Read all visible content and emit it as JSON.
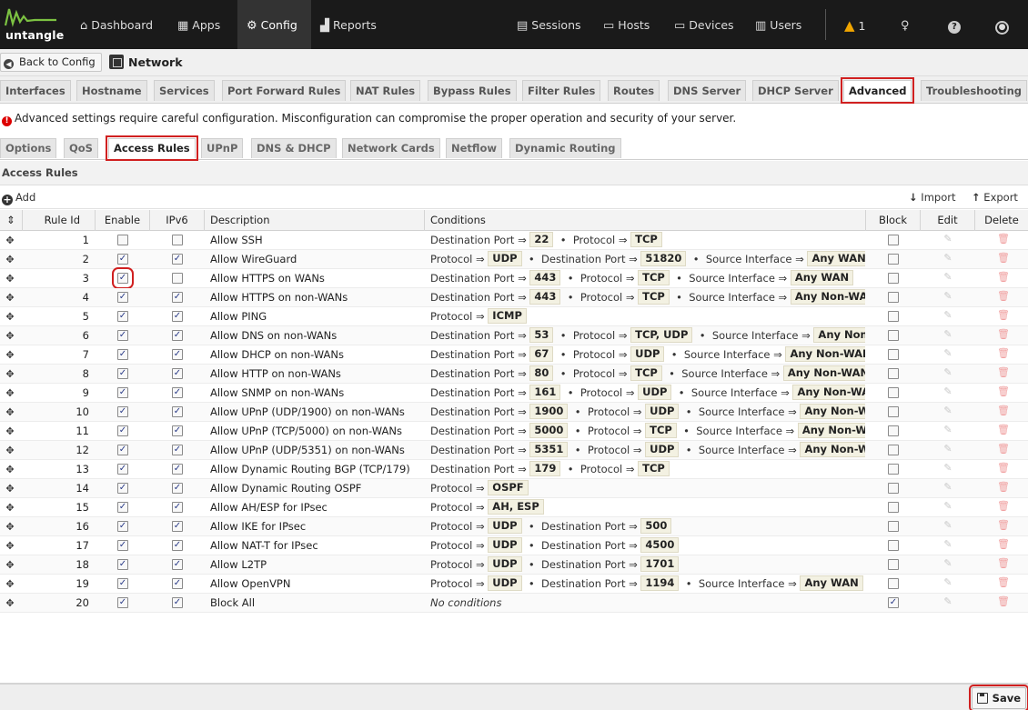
{
  "brand": {
    "name": "untangle"
  },
  "nav": {
    "dashboard": "Dashboard",
    "apps": "Apps",
    "config": "Config",
    "reports": "Reports",
    "sessions": "Sessions",
    "hosts": "Hosts",
    "devices": "Devices",
    "users": "Users",
    "alert_count": "1"
  },
  "breadcrumb": {
    "back_label": "Back to Config",
    "title": "Network"
  },
  "tabs": [
    "Interfaces",
    "Hostname",
    "Services",
    "Port Forward Rules",
    "NAT Rules",
    "Bypass Rules",
    "Filter Rules",
    "Routes",
    "DNS Server",
    "DHCP Server",
    "Advanced",
    "Troubleshooting"
  ],
  "warning": "Advanced settings require careful configuration. Misconfiguration can compromise the proper operation and security of your server.",
  "subtabs": [
    "Options",
    "QoS",
    "Access Rules",
    "UPnP",
    "DNS & DHCP",
    "Network Cards",
    "Netflow",
    "Dynamic Routing"
  ],
  "panel_title": "Access Rules",
  "toolbar": {
    "add": "Add",
    "import": "Import",
    "export": "Export"
  },
  "columns": {
    "rule_id": "Rule Id",
    "enable": "Enable",
    "ipv6": "IPv6",
    "description": "Description",
    "conditions": "Conditions",
    "block": "Block",
    "edit": "Edit",
    "delete": "Delete"
  },
  "rules": [
    {
      "id": "1",
      "enable": false,
      "ipv6": false,
      "block": false,
      "description": "Allow SSH",
      "conditions": [
        [
          "Destination Port",
          "22"
        ],
        [
          "Protocol",
          "TCP"
        ]
      ]
    },
    {
      "id": "2",
      "enable": true,
      "ipv6": true,
      "block": false,
      "description": "Allow WireGuard",
      "conditions": [
        [
          "Protocol",
          "UDP"
        ],
        [
          "Destination Port",
          "51820"
        ],
        [
          "Source Interface",
          "Any WAN"
        ]
      ]
    },
    {
      "id": "3",
      "enable": true,
      "ipv6": false,
      "block": false,
      "description": "Allow HTTPS on WANs",
      "conditions": [
        [
          "Destination Port",
          "443"
        ],
        [
          "Protocol",
          "TCP"
        ],
        [
          "Source Interface",
          "Any WAN"
        ]
      ]
    },
    {
      "id": "4",
      "enable": true,
      "ipv6": true,
      "block": false,
      "description": "Allow HTTPS on non-WANs",
      "conditions": [
        [
          "Destination Port",
          "443"
        ],
        [
          "Protocol",
          "TCP"
        ],
        [
          "Source Interface",
          "Any Non-WAN"
        ]
      ]
    },
    {
      "id": "5",
      "enable": true,
      "ipv6": true,
      "block": false,
      "description": "Allow PING",
      "conditions": [
        [
          "Protocol",
          "ICMP"
        ]
      ]
    },
    {
      "id": "6",
      "enable": true,
      "ipv6": true,
      "block": false,
      "description": "Allow DNS on non-WANs",
      "conditions": [
        [
          "Destination Port",
          "53"
        ],
        [
          "Protocol",
          "TCP, UDP"
        ],
        [
          "Source Interface",
          "Any Non-..."
        ]
      ]
    },
    {
      "id": "7",
      "enable": true,
      "ipv6": true,
      "block": false,
      "description": "Allow DHCP on non-WANs",
      "conditions": [
        [
          "Destination Port",
          "67"
        ],
        [
          "Protocol",
          "UDP"
        ],
        [
          "Source Interface",
          "Any Non-WAN"
        ]
      ]
    },
    {
      "id": "8",
      "enable": true,
      "ipv6": true,
      "block": false,
      "description": "Allow HTTP on non-WANs",
      "conditions": [
        [
          "Destination Port",
          "80"
        ],
        [
          "Protocol",
          "TCP"
        ],
        [
          "Source Interface",
          "Any Non-WAN"
        ]
      ]
    },
    {
      "id": "9",
      "enable": true,
      "ipv6": true,
      "block": false,
      "description": "Allow SNMP on non-WANs",
      "conditions": [
        [
          "Destination Port",
          "161"
        ],
        [
          "Protocol",
          "UDP"
        ],
        [
          "Source Interface",
          "Any Non-WAN"
        ]
      ]
    },
    {
      "id": "10",
      "enable": true,
      "ipv6": true,
      "block": false,
      "description": "Allow UPnP (UDP/1900) on non-WANs",
      "conditions": [
        [
          "Destination Port",
          "1900"
        ],
        [
          "Protocol",
          "UDP"
        ],
        [
          "Source Interface",
          "Any Non-W..."
        ]
      ]
    },
    {
      "id": "11",
      "enable": true,
      "ipv6": true,
      "block": false,
      "description": "Allow UPnP (TCP/5000) on non-WANs",
      "conditions": [
        [
          "Destination Port",
          "5000"
        ],
        [
          "Protocol",
          "TCP"
        ],
        [
          "Source Interface",
          "Any Non-W..."
        ]
      ]
    },
    {
      "id": "12",
      "enable": true,
      "ipv6": true,
      "block": false,
      "description": "Allow UPnP (UDP/5351) on non-WANs",
      "conditions": [
        [
          "Destination Port",
          "5351"
        ],
        [
          "Protocol",
          "UDP"
        ],
        [
          "Source Interface",
          "Any Non-W..."
        ]
      ]
    },
    {
      "id": "13",
      "enable": true,
      "ipv6": true,
      "block": false,
      "description": "Allow Dynamic Routing BGP (TCP/179)",
      "conditions": [
        [
          "Destination Port",
          "179"
        ],
        [
          "Protocol",
          "TCP"
        ]
      ]
    },
    {
      "id": "14",
      "enable": true,
      "ipv6": true,
      "block": false,
      "description": "Allow Dynamic Routing OSPF",
      "conditions": [
        [
          "Protocol",
          "OSPF"
        ]
      ]
    },
    {
      "id": "15",
      "enable": true,
      "ipv6": true,
      "block": false,
      "description": "Allow AH/ESP for IPsec",
      "conditions": [
        [
          "Protocol",
          "AH, ESP"
        ]
      ]
    },
    {
      "id": "16",
      "enable": true,
      "ipv6": true,
      "block": false,
      "description": "Allow IKE for IPsec",
      "conditions": [
        [
          "Protocol",
          "UDP"
        ],
        [
          "Destination Port",
          "500"
        ]
      ]
    },
    {
      "id": "17",
      "enable": true,
      "ipv6": true,
      "block": false,
      "description": "Allow NAT-T for IPsec",
      "conditions": [
        [
          "Protocol",
          "UDP"
        ],
        [
          "Destination Port",
          "4500"
        ]
      ]
    },
    {
      "id": "18",
      "enable": true,
      "ipv6": true,
      "block": false,
      "description": "Allow L2TP",
      "conditions": [
        [
          "Protocol",
          "UDP"
        ],
        [
          "Destination Port",
          "1701"
        ]
      ]
    },
    {
      "id": "19",
      "enable": true,
      "ipv6": true,
      "block": false,
      "description": "Allow OpenVPN",
      "conditions": [
        [
          "Protocol",
          "UDP"
        ],
        [
          "Destination Port",
          "1194"
        ],
        [
          "Source Interface",
          "Any WAN"
        ]
      ]
    },
    {
      "id": "20",
      "enable": true,
      "ipv6": true,
      "block": true,
      "description": "Block All",
      "conditions": [],
      "no_conditions": "No conditions"
    }
  ],
  "footer": {
    "save": "Save"
  },
  "colors": {
    "highlight": "#d02020",
    "topbar": "#1a1a1a",
    "value_chip": "#f3f1e2"
  }
}
